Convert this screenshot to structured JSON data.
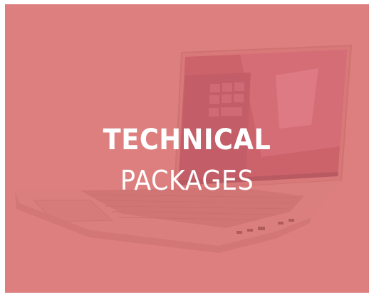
{
  "card": {
    "title_line1": "TECHNICAL",
    "title_line2": "PACKAGES",
    "image": "laptop-image",
    "overlay_color": "#dd7878"
  }
}
